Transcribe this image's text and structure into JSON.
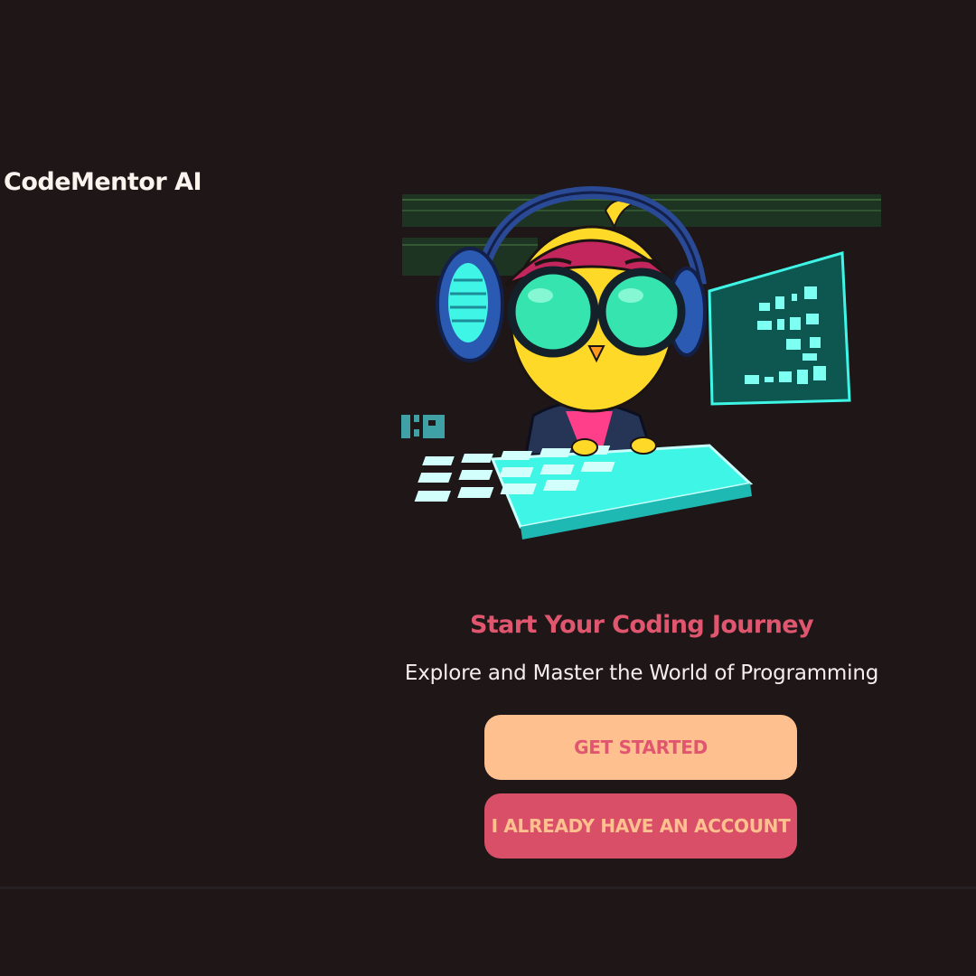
{
  "app": {
    "brand": "CodeMentor AI"
  },
  "hero": {
    "illustration": "coding-bird-mascot-illustration",
    "title": "Start Your Coding Journey",
    "subtitle": "Explore and Master the World of Programming"
  },
  "actions": {
    "get_started_label": "GET STARTED",
    "have_account_label": "I ALREADY HAVE AN ACCOUNT"
  },
  "colors": {
    "background": "#1e1617",
    "accent_pink": "#e0566f",
    "accent_peach": "#ffc090",
    "neon_cyan": "#3ff5e6"
  }
}
